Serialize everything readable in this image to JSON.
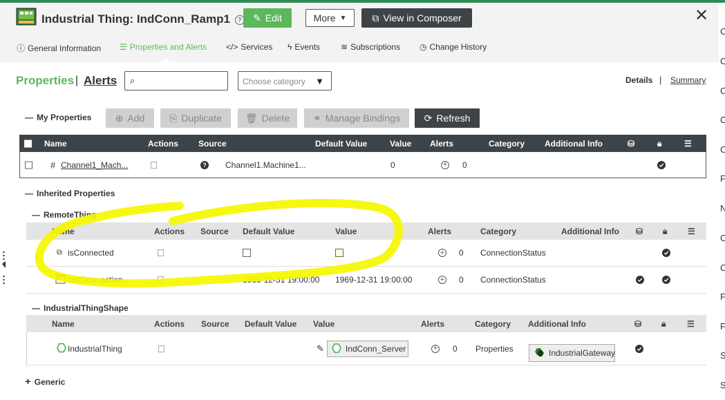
{
  "header": {
    "title": "Industrial Thing: IndConn_Ramp1",
    "edit_label": "Edit",
    "more_label": "More",
    "composer_label": "View in Composer"
  },
  "nav": {
    "items": [
      {
        "label": "General Information"
      },
      {
        "label": "Properties and Alerts"
      },
      {
        "label": "Services"
      },
      {
        "label": "Events"
      },
      {
        "label": "Subscriptions"
      },
      {
        "label": "Change History"
      }
    ]
  },
  "subheader": {
    "properties_label": "Properties",
    "alerts_label": "Alerts",
    "search_placeholder": "",
    "category_placeholder": "Choose category",
    "details_label": "Details",
    "summary_label": "Summary"
  },
  "my_properties": {
    "label": "My Properties",
    "toolbar": {
      "add": "Add",
      "duplicate": "Duplicate",
      "delete": "Delete",
      "manage_bindings": "Manage Bindings",
      "refresh": "Refresh"
    },
    "columns": [
      "Name",
      "Actions",
      "Source",
      "Default Value",
      "Value",
      "Alerts",
      "Category",
      "Additional Info"
    ],
    "rows": [
      {
        "name": "Channel1_Mach...",
        "source": "Channel1.Machine1...",
        "value": "0",
        "alerts": "0"
      }
    ]
  },
  "inherited": {
    "label": "Inherited Properties",
    "remote_thing": {
      "label": "RemoteThing",
      "columns": [
        "Name",
        "Actions",
        "Source",
        "Default Value",
        "Value",
        "Alerts",
        "Category",
        "Additional Info"
      ],
      "rows": [
        {
          "name": "isConnected",
          "default": "",
          "value": "",
          "alerts": "0",
          "category": "ConnectionStatus"
        },
        {
          "name": "lastConnection",
          "default": "1969-12-31 19:00:00",
          "value": "1969-12-31 19:00:00",
          "alerts": "0",
          "category": "ConnectionStatus"
        }
      ]
    },
    "industrial_shape": {
      "label": "IndustrialThingShape",
      "columns": [
        "Name",
        "Actions",
        "Source",
        "Default Value",
        "Value",
        "Alerts",
        "Category",
        "Additional Info"
      ],
      "rows": [
        {
          "name": "IndustrialThing",
          "value": "IndConn_Server",
          "alerts": "0",
          "category": "Properties",
          "additional": "IndustrialGateway"
        }
      ]
    }
  },
  "generic_label": "Generic",
  "right_edge_letters": [
    "C",
    "C",
    "C",
    "C",
    "C",
    "F",
    "N",
    "C",
    "C",
    "F",
    "F",
    "S",
    "S"
  ],
  "colors": {
    "accent_green": "#5cb85c",
    "dark_header": "#3e4347",
    "highlight_yellow": "#f6f600"
  }
}
